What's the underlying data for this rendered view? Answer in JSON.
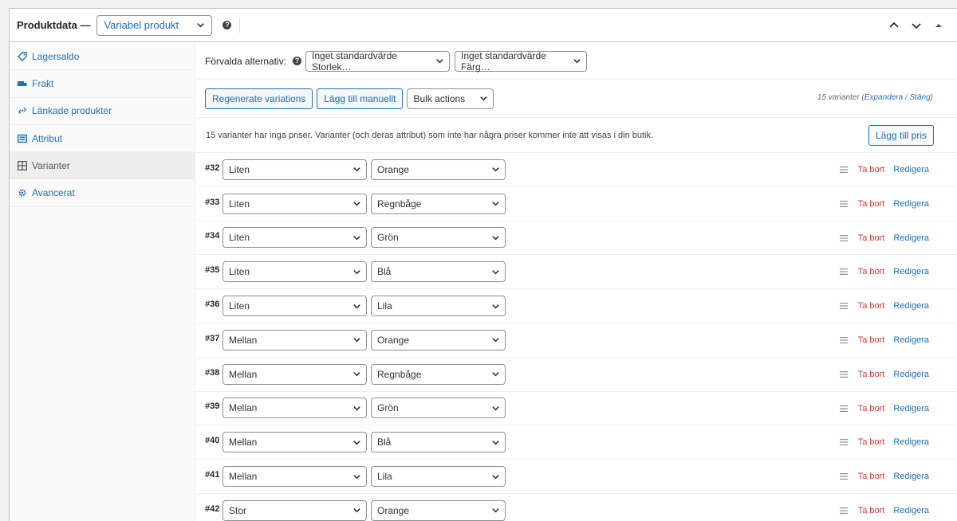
{
  "header": {
    "title": "Produktdata —",
    "product_type": "Variabel produkt"
  },
  "sidebar": {
    "items": [
      {
        "label": "Lagersaldo",
        "icon": "tag-icon"
      },
      {
        "label": "Frakt",
        "icon": "truck-icon"
      },
      {
        "label": "Länkade produkter",
        "icon": "link-icon"
      },
      {
        "label": "Attribut",
        "icon": "list-icon"
      },
      {
        "label": "Varianter",
        "icon": "grid-icon"
      },
      {
        "label": "Avancerat",
        "icon": "gear-icon"
      }
    ]
  },
  "defaults": {
    "label": "Förvalda alternativ:",
    "size_value": "Inget standardvärde Storlek…",
    "color_value": "Inget standardvärde Färg…"
  },
  "actions": {
    "regenerate": "Regenerate variations",
    "add_manual": "Lägg till manuellt",
    "bulk": "Bulk actions",
    "count_prefix": "15 varianter (",
    "expand": "Expandera",
    "separator": " / ",
    "close": "Stäng",
    "count_suffix": ")"
  },
  "notice": {
    "text": "15 varianter har inga priser. Varianter (och deras attribut) som inte har några priser kommer inte att visas i din butik.",
    "button": "Lägg till pris"
  },
  "row_actions": {
    "delete": "Ta bort",
    "edit": "Redigera"
  },
  "variations": [
    {
      "id": "#32",
      "size": "Liten",
      "color": "Orange"
    },
    {
      "id": "#33",
      "size": "Liten",
      "color": "Regnbåge"
    },
    {
      "id": "#34",
      "size": "Liten",
      "color": "Grön"
    },
    {
      "id": "#35",
      "size": "Liten",
      "color": "Blå"
    },
    {
      "id": "#36",
      "size": "Liten",
      "color": "Lila"
    },
    {
      "id": "#37",
      "size": "Mellan",
      "color": "Orange"
    },
    {
      "id": "#38",
      "size": "Mellan",
      "color": "Regnbåge"
    },
    {
      "id": "#39",
      "size": "Mellan",
      "color": "Grön"
    },
    {
      "id": "#40",
      "size": "Mellan",
      "color": "Blå"
    },
    {
      "id": "#41",
      "size": "Mellan",
      "color": "Lila"
    },
    {
      "id": "#42",
      "size": "Stor",
      "color": "Orange"
    }
  ]
}
